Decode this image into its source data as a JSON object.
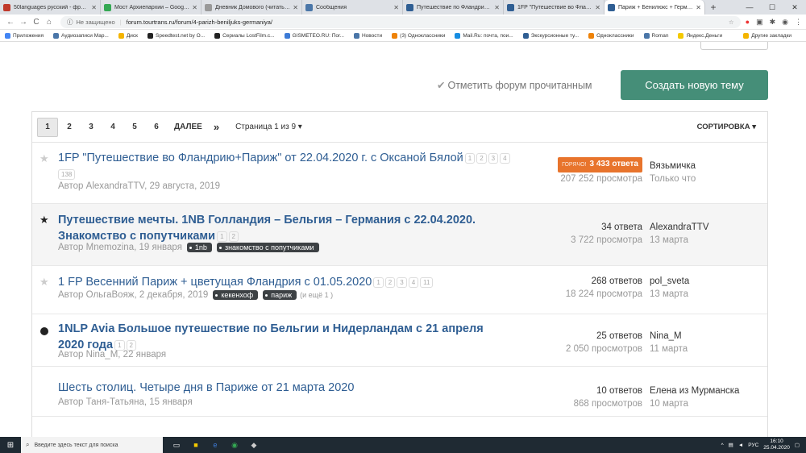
{
  "browser": {
    "tabs": [
      {
        "title": "50languages русский - французс",
        "color": "#c0392b",
        "active": false
      },
      {
        "title": "Мост Архиепархии – Google Ка",
        "color": "#34a853",
        "active": false
      },
      {
        "title": "Дневник Домового (читать онл",
        "color": "#999999",
        "active": false
      },
      {
        "title": "Сообщения",
        "color": "#4a76a8",
        "active": false
      },
      {
        "title": "Путешествие по Фландрию + П",
        "color": "#2f5e93",
        "active": false
      },
      {
        "title": "1FP \"Путешествие во Фландр",
        "color": "#2f5e93",
        "active": false
      },
      {
        "title": "Париж + Бенилюкс + Германи",
        "color": "#2f5e93",
        "active": true
      }
    ],
    "new_tab": "+",
    "win_min": "—",
    "win_max": "☐",
    "win_close": "✕",
    "nav_back": "←",
    "nav_forward": "→",
    "nav_reload": "C",
    "nav_home": "⌂",
    "security": "Не защищено",
    "url": "forum.tourtrans.ru/forum/4-parizh-beniljuks-germaniya/",
    "bookmarks": [
      {
        "label": "Приложения",
        "color": "#4285f4"
      },
      {
        "label": "Аудиозаписи Мар...",
        "color": "#4a76a8"
      },
      {
        "label": "Диск",
        "color": "#f4b400"
      },
      {
        "label": "Speedtest.net by O...",
        "color": "#222222"
      },
      {
        "label": "Сериалы LostFilm.c...",
        "color": "#222222"
      },
      {
        "label": "GISMETEO.RU: Пог...",
        "color": "#3d7bd6"
      },
      {
        "label": "Новости",
        "color": "#4a76a8"
      },
      {
        "label": "(3) Одноклассники",
        "color": "#ee8208"
      },
      {
        "label": "Mail.Ru: почта, пои...",
        "color": "#168de2"
      },
      {
        "label": "Экскурсионные ту...",
        "color": "#2f5e93"
      },
      {
        "label": "Одноклассники",
        "color": "#ee8208"
      },
      {
        "label": "Roman",
        "color": "#4a76a8"
      },
      {
        "label": "Яндекс.Деньги",
        "color": "#f4c900"
      }
    ],
    "other_bookmarks": "Другие закладки"
  },
  "forum": {
    "mark_read": "Отметить форум прочитанным",
    "create_topic": "Создать новую тему",
    "pages": [
      "1",
      "2",
      "3",
      "4",
      "5",
      "6"
    ],
    "next_label": "ДАЛЕЕ",
    "last_label": "»",
    "page_of": "Страница 1 из 9",
    "sort_label": "СОРТИРОВКА",
    "topics": [
      {
        "marker": "star",
        "bold": false,
        "title": "1FP \"Путешествие во Фландрию+Париж\" от 22.04.2020 г. с Оксаной Бялой",
        "mini_pages": [
          "1",
          "2",
          "3",
          "4"
        ],
        "mini_pages_line2": [
          "138"
        ],
        "author": "Автор AlexandraTTV, 29 августа, 2019",
        "tags": [],
        "more": "",
        "hot_label": "ГОРЯЧО!",
        "answers": "3 433 ответа",
        "views": "207 252 просмотра",
        "last_user": "Вязьмичка",
        "last_time": "Только что"
      },
      {
        "marker": "star-filled",
        "bold": true,
        "title": "Путешествие мечты. 1NB Голландия – Бельгия – Германия с 22.04.2020. Знакомство с попутчиками",
        "mini_pages": [
          "1",
          "2"
        ],
        "author": "Автор Mnemozina, 19 января",
        "tags": [
          "1nb",
          "знакомство с попутчиками"
        ],
        "more": "",
        "answers": "34 ответа",
        "views": "3 722 просмотра",
        "last_user": "AlexandraTTV",
        "last_time": "13 марта"
      },
      {
        "marker": "star",
        "bold": false,
        "title": "1 FP Весенний Париж + цветущая Фландрия с 01.05.2020",
        "mini_pages": [
          "1",
          "2",
          "3",
          "4",
          "11"
        ],
        "author": "Автор ОльгаВояж, 2 декабря, 2019",
        "tags": [
          "кекенхоф",
          "париж"
        ],
        "more": "(и ещё 1 )",
        "answers": "268 ответов",
        "views": "18 224 просмотра",
        "last_user": "pol_sveta",
        "last_time": "13 марта"
      },
      {
        "marker": "dot",
        "bold": true,
        "title": "1NLP Avia Большое путешествие по Бельгии и Нидерландам с 21 апреля 2020 года",
        "mini_pages": [
          "1",
          "2"
        ],
        "author": "Автор Nina_M, 22 января",
        "tags": [],
        "more": "",
        "answers": "25 ответов",
        "views": "2 050 просмотров",
        "last_user": "Nina_M",
        "last_time": "11 марта"
      },
      {
        "marker": "none",
        "bold": false,
        "title": "Шесть столиц. Четыре дня в Париже от 21 марта 2020",
        "mini_pages": [],
        "author": "Автор Таня-Татьяна, 15 января",
        "tags": [],
        "more": "",
        "answers": "10 ответов",
        "views": "868 просмотров",
        "last_user": "Елена из Мурманска",
        "last_time": "10 марта"
      }
    ]
  },
  "taskbar": {
    "start_icon": "⊞",
    "search_placeholder": "Введите здесь текст для поиска",
    "lang": "РУС",
    "time": "16:10",
    "date": "25.04.2020"
  }
}
